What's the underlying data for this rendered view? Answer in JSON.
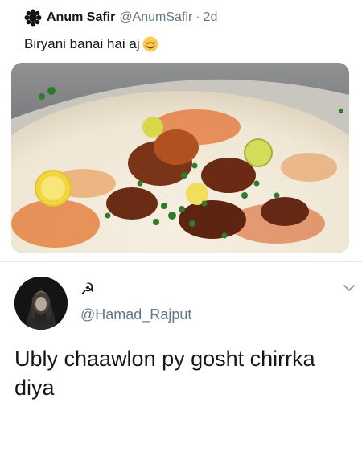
{
  "quoted_tweet": {
    "author_name": "Anum Safir",
    "author_handle": "@AnumSafir",
    "separator": "·",
    "time": "2d",
    "text": "Biryani banai hai aj",
    "emoji": "relieved-face-emoji",
    "media": "biryani-photo"
  },
  "reply": {
    "author_name": "☭",
    "author_handle": "@Hamad_Rajput",
    "text": "Ubly chaawlon py gosht chirrka diya",
    "menu_icon": "chevron-down-icon"
  }
}
